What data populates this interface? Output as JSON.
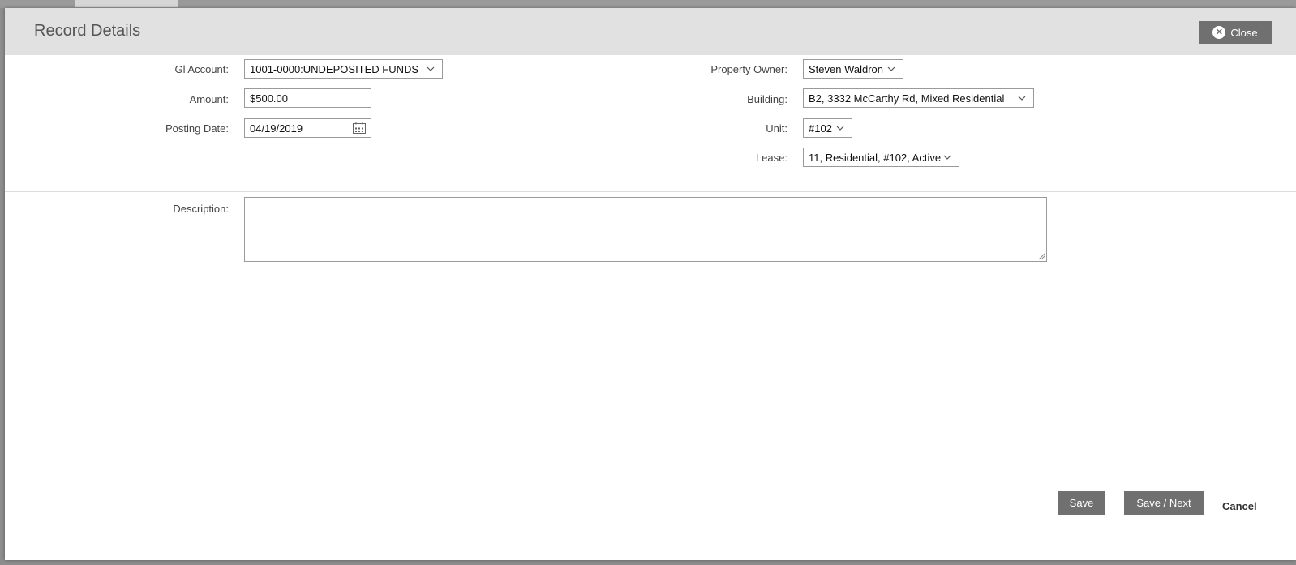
{
  "modal": {
    "title": "Record Details",
    "close_label": "Close"
  },
  "form": {
    "gl_account": {
      "label": "Gl Account:",
      "value": "1001-0000:UNDEPOSITED FUNDS"
    },
    "amount": {
      "label": "Amount:",
      "value": "$500.00"
    },
    "posting_date": {
      "label": "Posting Date:",
      "value": "04/19/2019"
    },
    "property_owner": {
      "label": "Property Owner:",
      "value": "Steven Waldron"
    },
    "building": {
      "label": "Building:",
      "value": "B2, 3332 McCarthy Rd, Mixed Residential"
    },
    "unit": {
      "label": "Unit:",
      "value": "#102"
    },
    "lease": {
      "label": "Lease:",
      "value": "11, Residential, #102, Active"
    },
    "description": {
      "label": "Description:",
      "value": ""
    }
  },
  "actions": {
    "save_label": "Save",
    "save_next_label": "Save / Next",
    "cancel_label": "Cancel"
  },
  "icons": {
    "close": "close-circle-icon",
    "dropdown": "chevron-down-icon",
    "calendar": "calendar-icon"
  },
  "colors": {
    "header_bg": "#e1e1e1",
    "button_bg": "#707070",
    "backdrop": "#8d8d8d"
  }
}
